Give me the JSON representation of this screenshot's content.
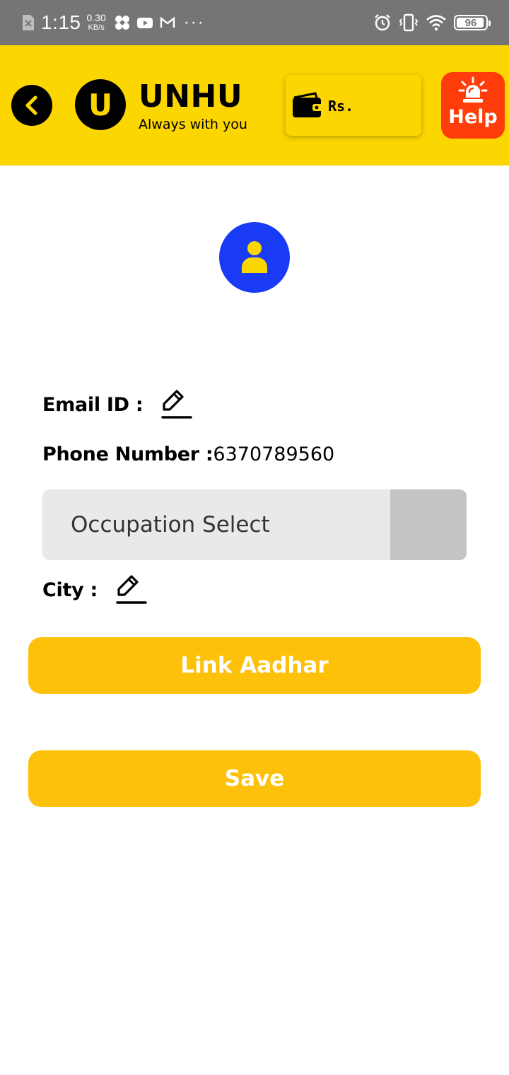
{
  "status_bar": {
    "time": "1:15",
    "net_speed_value": "0.30",
    "net_speed_unit": "KB/s",
    "overflow": "···",
    "battery_level": "96",
    "battery_fraction": 0.96
  },
  "header": {
    "brand_initial": "U",
    "brand_name": "UNHU",
    "tagline": "Always with you",
    "wallet_label": "Rs.",
    "help_label": "Help",
    "colors": {
      "header_bg": "#FCD601",
      "help_bg": "#FF3D0A"
    }
  },
  "profile": {
    "avatar_color": "#1A3BF5",
    "email_label": "Email ID :",
    "phone_label": "Phone Number :",
    "phone_value": "6370789560",
    "occupation_placeholder": "Occupation Select",
    "city_label": "City :"
  },
  "actions": {
    "link_aadhar": "Link Aadhar",
    "save": "Save",
    "button_color": "#FCC108"
  }
}
